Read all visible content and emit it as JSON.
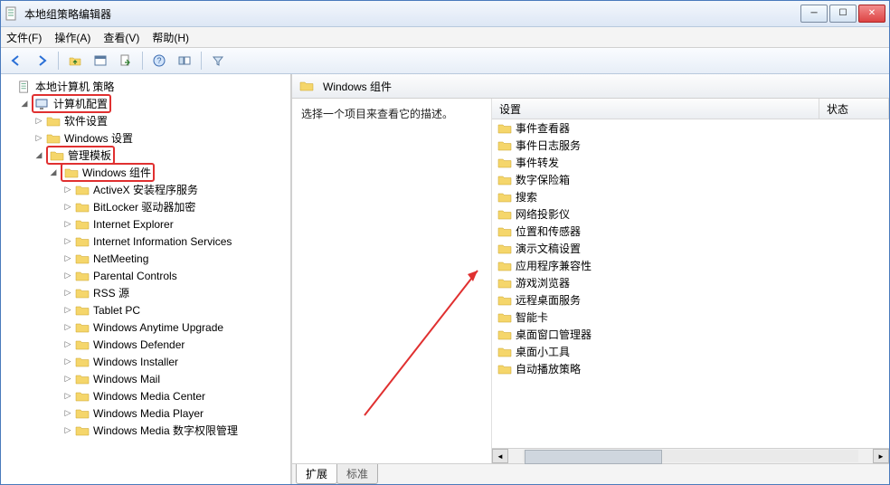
{
  "window": {
    "title": "本地组策略编辑器"
  },
  "menu": {
    "file": "文件(F)",
    "action": "操作(A)",
    "view": "查看(V)",
    "help": "帮助(H)"
  },
  "tree": {
    "root": "本地计算机 策略",
    "computer_config": "计算机配置",
    "software_settings": "软件设置",
    "windows_settings": "Windows 设置",
    "admin_templates": "管理模板",
    "windows_components": "Windows 组件",
    "children": [
      "ActiveX 安装程序服务",
      "BitLocker 驱动器加密",
      "Internet Explorer",
      "Internet Information Services",
      "NetMeeting",
      "Parental Controls",
      "RSS 源",
      "Tablet PC",
      "Windows Anytime Upgrade",
      "Windows Defender",
      "Windows Installer",
      "Windows Mail",
      "Windows Media Center",
      "Windows Media Player",
      "Windows Media 数字权限管理"
    ]
  },
  "detail": {
    "header": "Windows 组件",
    "prompt": "选择一个项目来查看它的描述。",
    "col_setting": "设置",
    "col_state": "状态",
    "items": [
      "事件查看器",
      "事件日志服务",
      "事件转发",
      "数字保险箱",
      "搜索",
      "网络投影仪",
      "位置和传感器",
      "演示文稿设置",
      "应用程序兼容性",
      "游戏浏览器",
      "远程桌面服务",
      "智能卡",
      "桌面窗口管理器",
      "桌面小工具",
      "自动播放策略"
    ]
  },
  "tabs": {
    "extended": "扩展",
    "standard": "标准"
  }
}
